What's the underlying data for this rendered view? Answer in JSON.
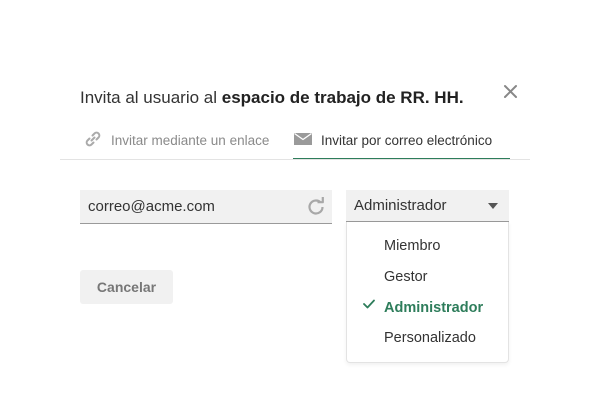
{
  "dialog": {
    "title_prefix": "Invita al usuario al ",
    "title_bold": "espacio de trabajo de RR. HH."
  },
  "tabs": [
    {
      "label": "Invitar mediante un enlace",
      "icon": "link-icon",
      "active": false
    },
    {
      "label": "Invitar por correo electrónico",
      "icon": "mail-icon",
      "active": true
    }
  ],
  "email_field": {
    "value": "correo@acme.com"
  },
  "role_select": {
    "selected": "Administrador",
    "options": [
      "Miembro",
      "Gestor",
      "Administrador",
      "Personalizado"
    ]
  },
  "buttons": {
    "cancel": "Cancelar"
  },
  "colors": {
    "accent": "#2e7d5b",
    "field_bg": "#f1f1f1",
    "muted": "#8a8a8a"
  }
}
